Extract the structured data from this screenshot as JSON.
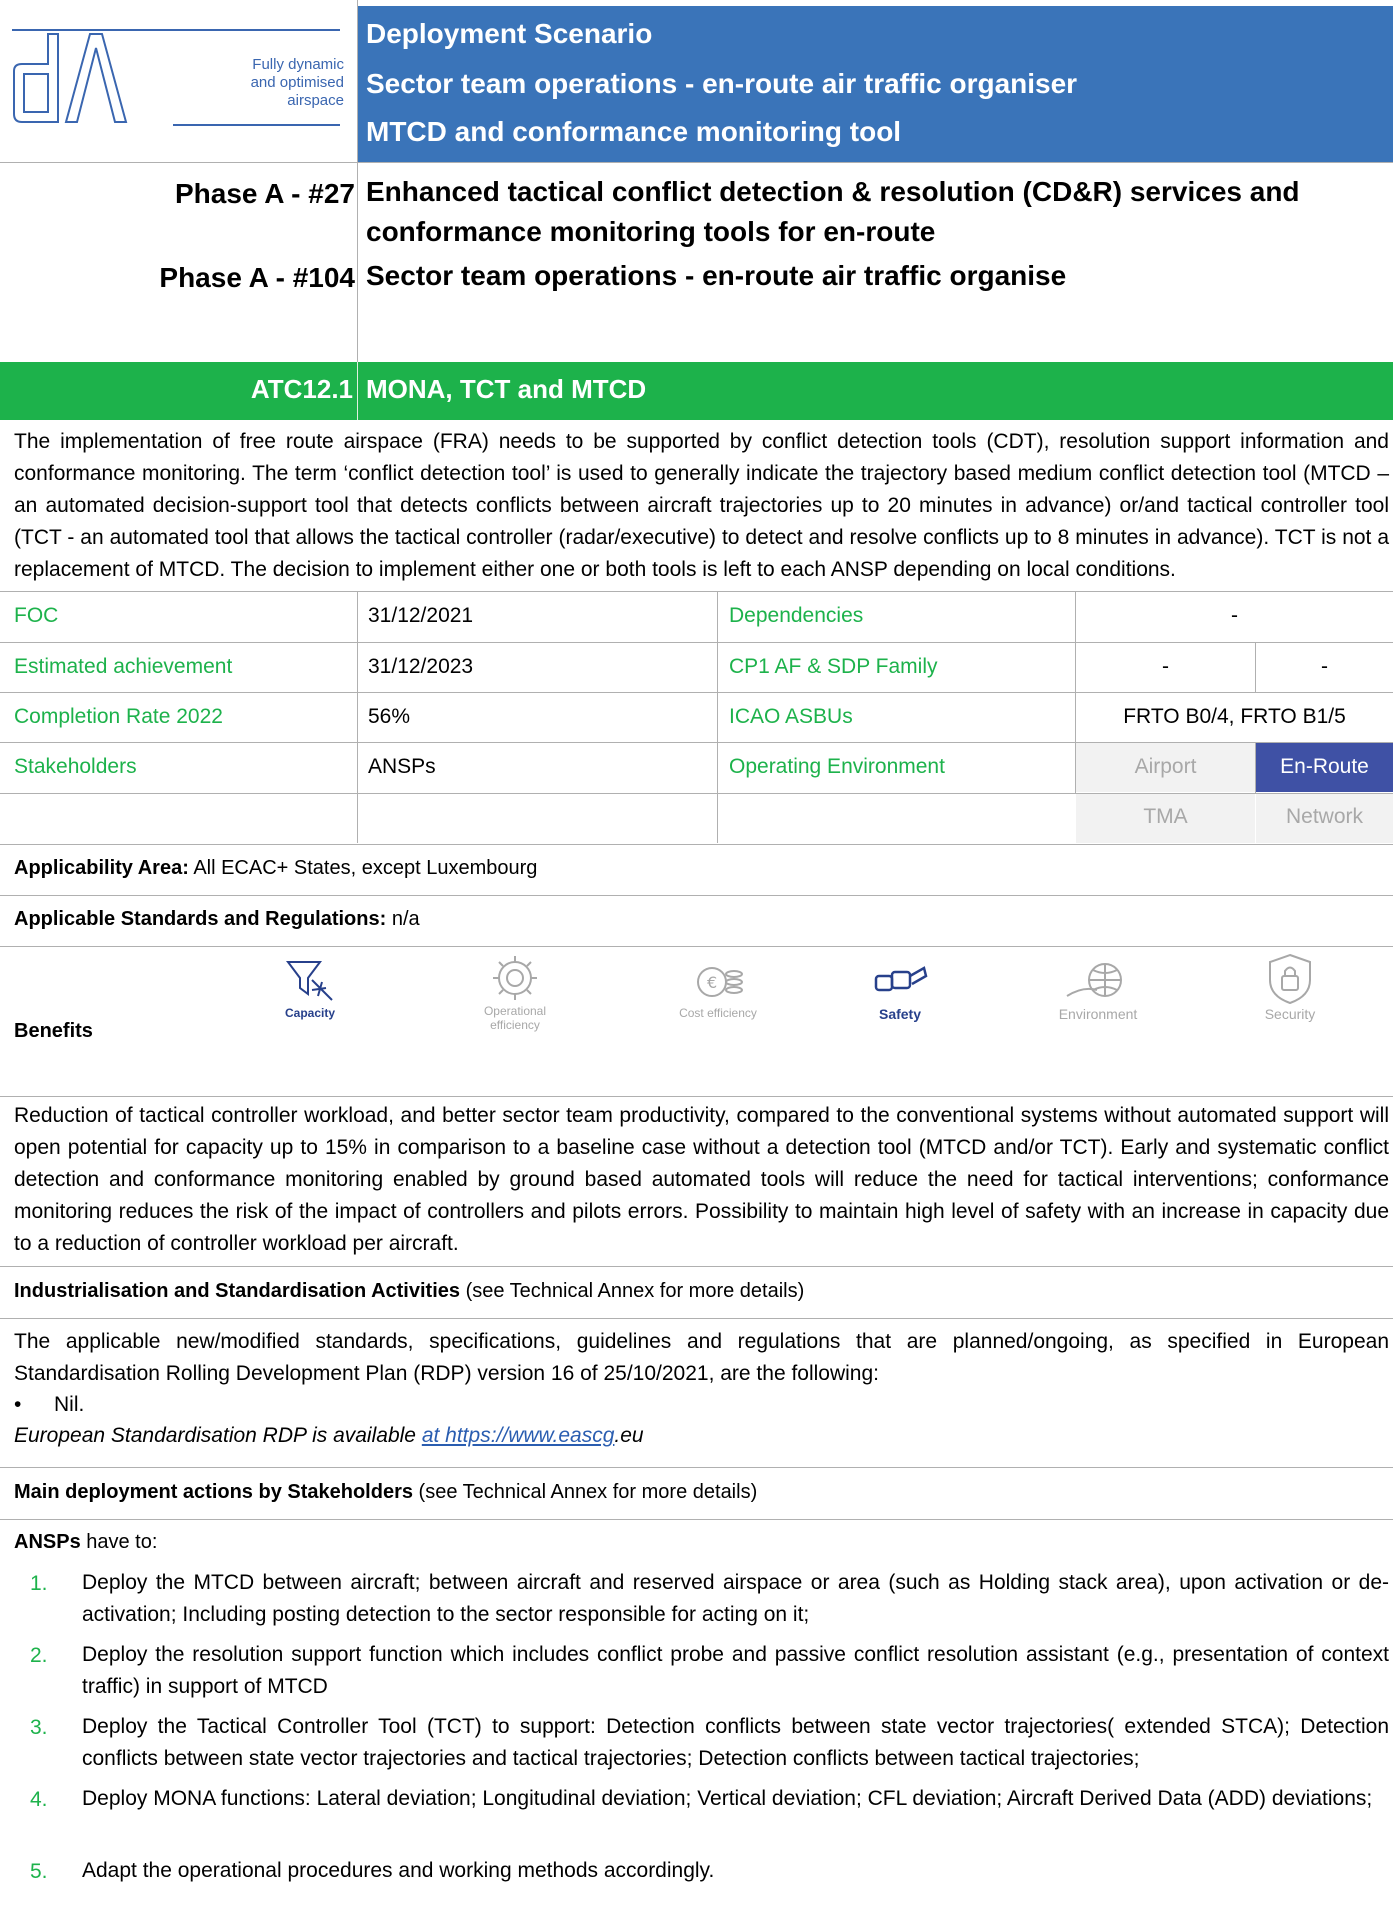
{
  "logo": {
    "letters": "dA",
    "line1": "Fully dynamic",
    "line2": "and optimised",
    "line3": "airspace"
  },
  "header": {
    "line1": "Deployment Scenario",
    "line2": "Sector team operations - en-route air traffic organiser",
    "line3": "MTCD and conformance monitoring tool",
    "bg_color": "#3a74b9"
  },
  "phases": [
    {
      "label": "Phase A - #27",
      "text": "Enhanced tactical conflict detection & resolution (CD&R) services and conformance monitoring tools for en-route"
    },
    {
      "label": "Phase A - #104",
      "text": "Sector team operations - en-route air traffic organise"
    }
  ],
  "atc": {
    "code": "ATC12.1",
    "title": "MONA, TCT and MTCD",
    "bg_color": "#1db24b"
  },
  "intro": "The implementation of free route airspace (FRA) needs to be supported by conflict detection tools (CDT), resolution support information and conformance monitoring. The term ‘conflict detection tool’ is used to generally indicate the trajectory based medium conflict detection tool (MTCD – an automated decision-support tool that detects conflicts between aircraft trajectories up to 20 minutes in advance) or/and tactical controller tool (TCT - an automated tool that allows the tactical controller (radar/executive) to detect and resolve conflicts up to 8 minutes in advance). TCT is not a replacement of MTCD. The decision to implement either one or both tools is left to each ANSP depending on local conditions.",
  "table": {
    "foc_label": "FOC",
    "foc_value": "31/12/2021",
    "dep_label": "Dependencies",
    "dep_value": "-",
    "est_label": "Estimated achievement",
    "est_value": "31/12/2023",
    "cp1_label": "CP1 AF & SDP Family",
    "cp1_v1": "-",
    "cp1_v2": "-",
    "comp_label": "Completion Rate 2022",
    "comp_value": "56%",
    "icao_label": "ICAO ASBUs",
    "icao_value": "FRTO B0/4, FRTO B1/5",
    "stake_label": "Stakeholders",
    "stake_value": "ANSPs",
    "env_label": "Operating Environment",
    "env_airport": "Airport",
    "env_enroute": "En-Route",
    "env_tma": "TMA",
    "env_network": "Network"
  },
  "applicability": {
    "label": "Applicability Area:",
    "value": " All ECAC+ States, except Luxembourg"
  },
  "standards": {
    "label": "Applicable Standards and Regulations:",
    "value": " n/a"
  },
  "benefits": {
    "label": "Benefits",
    "items": [
      {
        "name": "Capacity",
        "active": true
      },
      {
        "name": "Operational efficiency",
        "active": false
      },
      {
        "name": "Cost efficiency",
        "active": false
      },
      {
        "name": "Safety",
        "active": true
      },
      {
        "name": "Environment",
        "active": false
      },
      {
        "name": "Security",
        "active": false
      }
    ]
  },
  "benefits_text": "Reduction of tactical controller workload, and better sector team productivity, compared to the conventional systems without automated support will open potential for capacity up to 15% in comparison to a baseline case without a detection tool (MTCD and/or TCT). Early and systematic conflict detection and conformance monitoring enabled by ground based automated tools will reduce the need for tactical interventions; conformance monitoring reduces the risk of the impact of controllers and pilots errors. Possibility to maintain high level of safety with an increase in capacity due to a reduction of controller workload per aircraft.",
  "industrialisation": {
    "heading": "Industrialisation and Standardisation Activities",
    "heading_note": " (see Technical Annex for more details)",
    "text": "The applicable new/modified standards, specifications, guidelines and regulations that are planned/ongoing, as specified in European Standardisation Rolling Development Plan (RDP) version 16 of 25/10/2021, are the following:",
    "bullet": "Nil.",
    "rdp_prefix": "European Standardisation RDP is available ",
    "rdp_link": "at https://www.eascg",
    "rdp_suffix": ".eu"
  },
  "deployment": {
    "heading": "Main deployment actions by Stakeholders",
    "heading_note": " (see Technical Annex for more details)",
    "who": "ANSPs",
    "who_suffix": " have to:",
    "items": [
      {
        "n": "1.",
        "text": "Deploy  the MTCD between aircraft; between aircraft and reserved airspace or area (such as Holding stack area), upon activation or de-activation; Including posting detection to the sector responsible for acting on it;"
      },
      {
        "n": "2.",
        "text": "Deploy the resolution support function which includes conflict probe and passive conflict resolution assistant (e.g., presentation of context traffic) in support of MTCD"
      },
      {
        "n": "3.",
        "text": "Deploy  the Tactical Controller Tool (TCT) to support: Detection conflicts  between state vector trajectories( extended STCA); Detection conflicts  between state vector trajectories and tactical trajectories; Detection conflicts  between tactical trajectories;"
      },
      {
        "n": "4.",
        "text": "Deploy MONA functions: Lateral deviation; Longitudinal deviation; Vertical deviation; CFL deviation; Aircraft Derived Data (ADD) deviations;"
      },
      {
        "n": "5.",
        "text": "Adapt the operational procedures and working methods accordingly."
      }
    ]
  }
}
